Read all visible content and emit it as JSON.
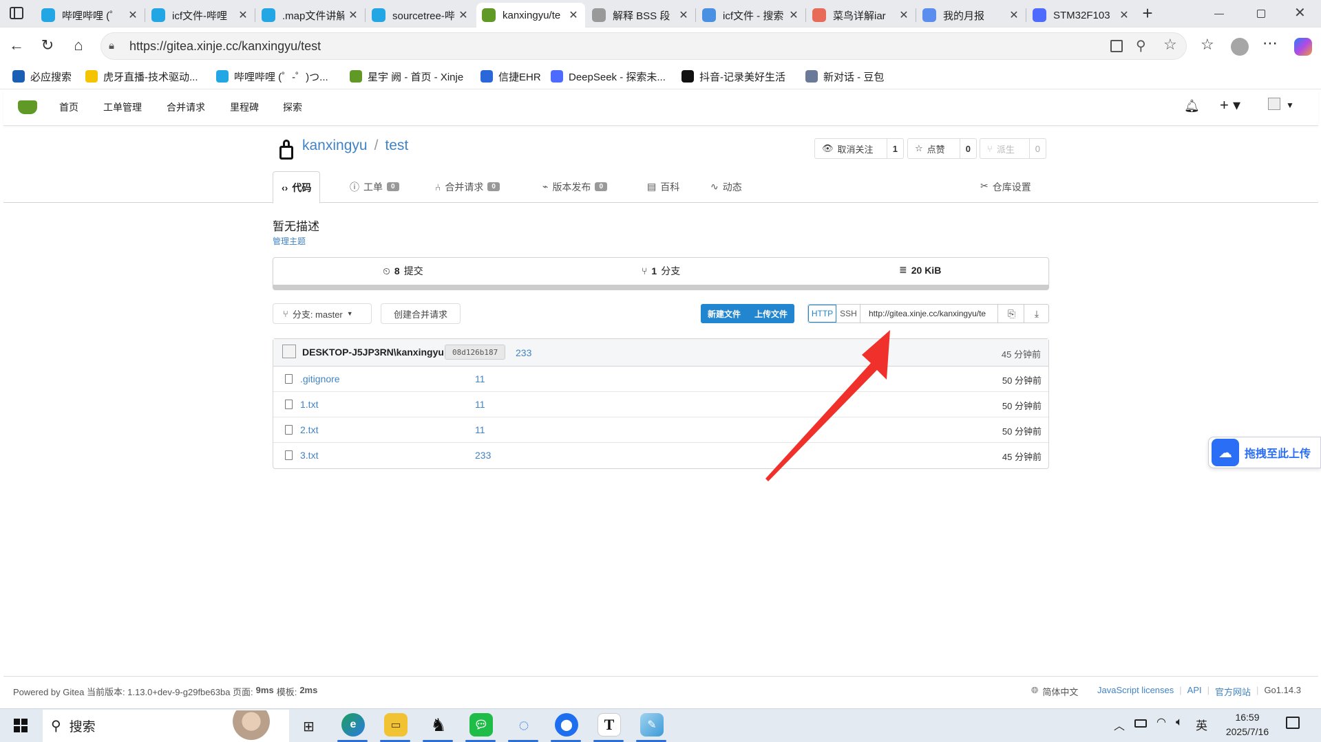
{
  "browser": {
    "tabs": [
      {
        "title": "哔哩哔哩 (゜",
        "icon": "bilibili-icon",
        "color": "#23a6e4"
      },
      {
        "title": "icf文件-哔哩",
        "icon": "bilibili-icon",
        "color": "#23a6e4"
      },
      {
        "title": ".map文件讲解",
        "icon": "bilibili-icon",
        "color": "#23a6e4"
      },
      {
        "title": "sourcetree-哔",
        "icon": "bilibili-icon",
        "color": "#23a6e4"
      },
      {
        "title": "kanxingyu/te",
        "icon": "gitea-icon",
        "color": "#609926",
        "active": true
      },
      {
        "title": "解释 BSS 段",
        "icon": "ai-avatar-icon",
        "color": "#999999"
      },
      {
        "title": "icf文件 - 搜索",
        "icon": "search-icon",
        "color": "#4a90e2"
      },
      {
        "title": "菜鸟详解iar",
        "icon": "csdn-icon",
        "color": "#e86b5a"
      },
      {
        "title": "我的月报",
        "icon": "feather-icon",
        "color": "#5b8def"
      },
      {
        "title": "STM32F103",
        "icon": "deepseek-icon",
        "color": "#4d6bfe"
      }
    ],
    "new_tab": "+",
    "url": "https://gitea.xinje.cc/kanxingyu/test",
    "bookmarks": [
      {
        "label": "必应搜索",
        "icon": "search-icon",
        "color": "#1a5fb4"
      },
      {
        "label": "虎牙直播-技术驱动...",
        "icon": "huya-icon",
        "color": "#f5c400"
      },
      {
        "label": "哔哩哔哩 (゜-゜)つ...",
        "icon": "bilibili-icon",
        "color": "#23a6e4"
      },
      {
        "label": "星宇 阙 - 首页 - Xinje",
        "icon": "gitea-icon",
        "color": "#609926"
      },
      {
        "label": "信捷EHR",
        "icon": "ehr-icon",
        "color": "#2a67d8"
      },
      {
        "label": "DeepSeek - 探索未...",
        "icon": "deepseek-icon",
        "color": "#4d6bfe"
      },
      {
        "label": "抖音-记录美好生活",
        "icon": "douyin-icon",
        "color": "#111111"
      },
      {
        "label": "新对话 - 豆包",
        "icon": "doubao-icon",
        "color": "#6b7a99"
      }
    ]
  },
  "gitea": {
    "nav": [
      "首页",
      "工单管理",
      "合并请求",
      "里程碑",
      "探索"
    ],
    "owner": "kanxingyu",
    "repo": "test",
    "watch": {
      "label": "取消关注",
      "count": "1"
    },
    "star": {
      "label": "点赞",
      "count": "0"
    },
    "fork": {
      "label": "派生",
      "count": "0"
    },
    "tabs": [
      {
        "label": "代码",
        "badge": null
      },
      {
        "label": "工单",
        "badge": "0"
      },
      {
        "label": "合并请求",
        "badge": "0"
      },
      {
        "label": "版本发布",
        "badge": "0"
      },
      {
        "label": "百科",
        "badge": null
      },
      {
        "label": "动态",
        "badge": null
      }
    ],
    "settings": "仓库设置",
    "description": "暂无描述",
    "manage_topics": "管理主题",
    "stats": {
      "commits": "8",
      "commits_label": "提交",
      "branches": "1",
      "branches_label": "分支",
      "size": "20 KiB"
    },
    "branch_label": "分支: master",
    "create_pr": "创建合并请求",
    "new_file": "新建文件",
    "upload_file": "上传文件",
    "clone_http": "HTTP",
    "clone_ssh": "SSH",
    "clone_url": "http://gitea.xinje.cc/kanxingyu/te",
    "latest_commit": {
      "author": "DESKTOP-J5JP3RN\\kanxingyu",
      "sha": "08d126b187",
      "message": "233",
      "time": "45 分钟前"
    },
    "files": [
      {
        "name": ".gitignore",
        "message": "11",
        "time": "50 分钟前"
      },
      {
        "name": "1.txt",
        "message": "11",
        "time": "50 分钟前"
      },
      {
        "name": "2.txt",
        "message": "11",
        "time": "50 分钟前"
      },
      {
        "name": "3.txt",
        "message": "233",
        "time": "45 分钟前"
      }
    ],
    "upload_widget": "拖拽至此上传"
  },
  "footer": {
    "powered": "Powered by Gitea 当前版本: 1.13.0+dev-9-g29fbe63ba 页面:",
    "page_time": "9ms",
    "tpl_label": "模板:",
    "tpl_time": "2ms",
    "language": "简体中文",
    "links": [
      "JavaScript licenses",
      "API",
      "官方网站"
    ],
    "go_version": "Go1.14.3"
  },
  "taskbar": {
    "search": "搜索",
    "time": "16:59",
    "date": "2025/7/16",
    "ime": "英"
  }
}
